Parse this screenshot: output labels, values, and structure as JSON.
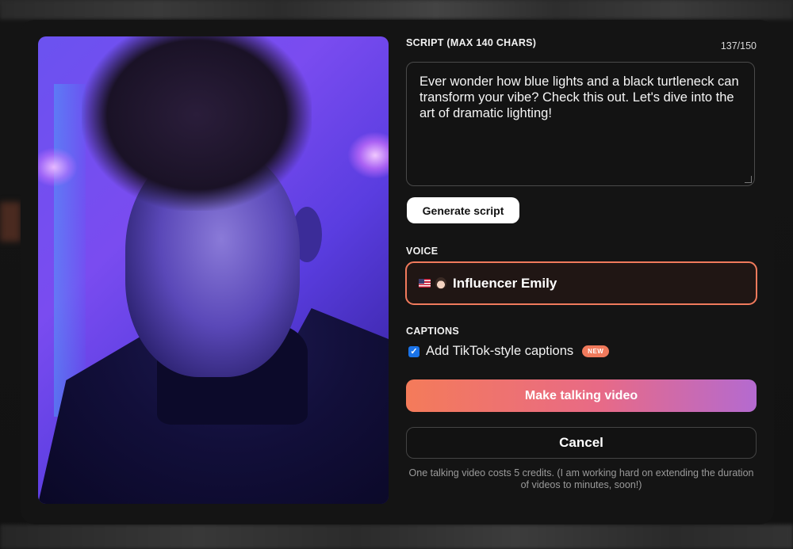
{
  "script": {
    "label": "SCRIPT (MAX 140 CHARS)",
    "counter": "137/150",
    "text": "Ever wonder how blue lights and a black turtleneck can transform your vibe? Check this out. Let's dive into the art of dramatic lighting!",
    "generate_label": "Generate script"
  },
  "voice": {
    "label": "VOICE",
    "selected": "Influencer Emily",
    "flag_icon": "us-flag-icon",
    "avatar_icon": "woman-emoji-icon"
  },
  "captions": {
    "label": "CAPTIONS",
    "option_label": "Add TikTok-style captions",
    "checked": true,
    "badge": "NEW"
  },
  "actions": {
    "make_label": "Make talking video",
    "cancel_label": "Cancel"
  },
  "footnote": "One talking video costs 5 credits. (I am working hard on extending the duration of videos to minutes, soon!)",
  "colors": {
    "accent_border": "#f07a5c",
    "gradient_start": "#f47b5a",
    "gradient_end": "#b46ad0",
    "checkbox": "#1a73e8"
  }
}
